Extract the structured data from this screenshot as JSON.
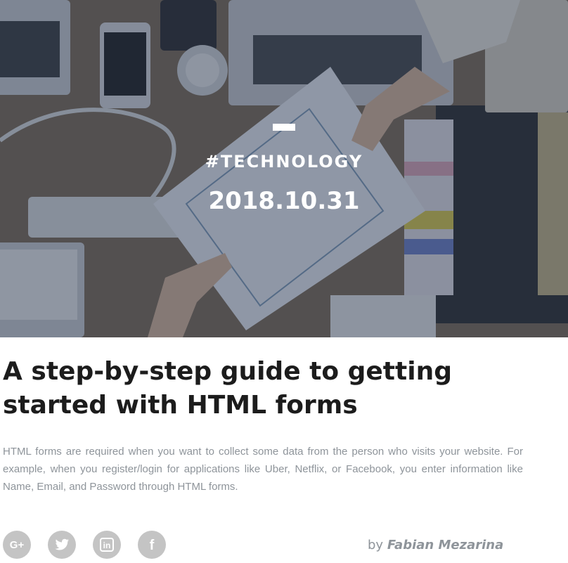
{
  "hero": {
    "category": "#TECHNOLOGY",
    "date": "2018.10.31"
  },
  "article": {
    "title": "A step-by-step guide to getting started with HTML forms",
    "excerpt": "HTML forms are required when you want to collect some data from the person who visits your website. For example, when you register/login for applications like Uber, Netflix, or Facebook, you enter information like Name, Email, and Password through HTML forms."
  },
  "share": {
    "icons": [
      "google-plus-icon",
      "twitter-icon",
      "linkedin-icon",
      "facebook-icon"
    ],
    "google_plus_label": "G+",
    "linkedin_label": "in",
    "facebook_label": "f"
  },
  "byline": {
    "prefix": "by",
    "author": "Fabian Mezarina"
  },
  "colors": {
    "title": "#1c1c1c",
    "muted_text": "#8e949a",
    "share_icon_bg": "#c4c4c4",
    "hero_overlay": "#23304a"
  }
}
